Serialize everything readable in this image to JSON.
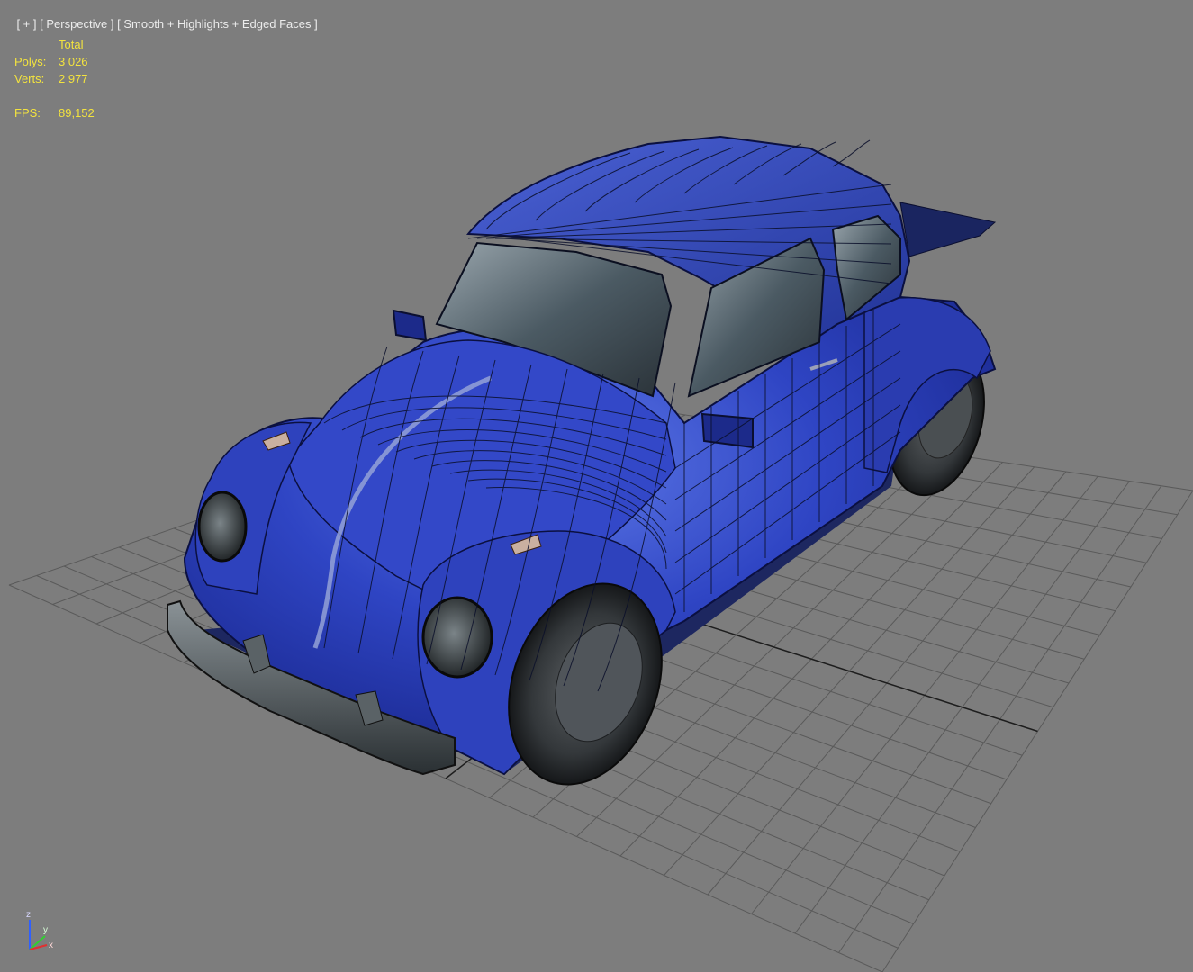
{
  "viewport": {
    "label_plus": "[ + ]",
    "label_view": "[ Perspective ]",
    "label_shading": "[ Smooth + Highlights + Edged Faces ]"
  },
  "stats": {
    "header": "Total",
    "polys_label": "Polys:",
    "polys_value": "3 026",
    "verts_label": "Verts:",
    "verts_value": "2 977",
    "fps_label": "FPS:",
    "fps_value": "89,152"
  },
  "axis": {
    "z": "z",
    "y": "y",
    "x": "x"
  },
  "colors": {
    "background": "#7d7d7d",
    "stats_text": "#f3e33e",
    "label_text": "#ececec",
    "car_body": "#2c3fb8",
    "grid": "#5a5a5a",
    "axis_x": "#e03030",
    "axis_y": "#30d030",
    "axis_z": "#3060ff"
  },
  "model": {
    "name_icon": "beetle-car-model"
  }
}
